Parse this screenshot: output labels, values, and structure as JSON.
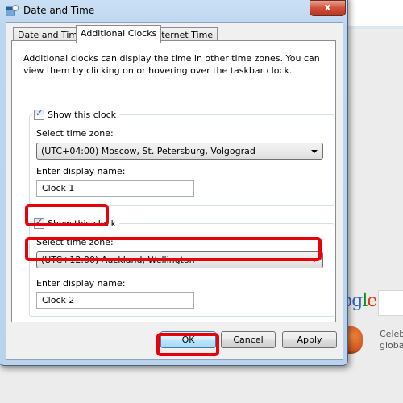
{
  "window": {
    "title": "Date and Time",
    "close_label": "x"
  },
  "tabs": [
    {
      "label": "Date and Time",
      "active": false
    },
    {
      "label": "Additional Clocks",
      "active": true
    },
    {
      "label": "Internet Time",
      "active": false
    }
  ],
  "panel": {
    "description": "Additional clocks can display the time in other time zones. You can view them by clicking on or hovering over the taskbar clock."
  },
  "clocks": [
    {
      "show_label": "Show this clock",
      "checked": true,
      "timezone_label": "Select time zone:",
      "timezone_value": "(UTC+04:00) Moscow, St. Petersburg, Volgograd",
      "name_label": "Enter display name:",
      "name_value": "Clock 1"
    },
    {
      "show_label": "Show this clock",
      "checked": true,
      "timezone_label": "Select time zone:",
      "timezone_value": "(UTC+12:00) Auckland, Wellington",
      "name_label": "Enter display name:",
      "name_value": "Clock 2"
    }
  ],
  "buttons": {
    "ok": "OK",
    "cancel": "Cancel",
    "apply": "Apply"
  },
  "background": {
    "logo_partial": [
      "o",
      "g",
      "l",
      "e"
    ],
    "snippet_line1": "Celeb",
    "snippet_line2": "global"
  },
  "highlight_color": "#e8000b"
}
